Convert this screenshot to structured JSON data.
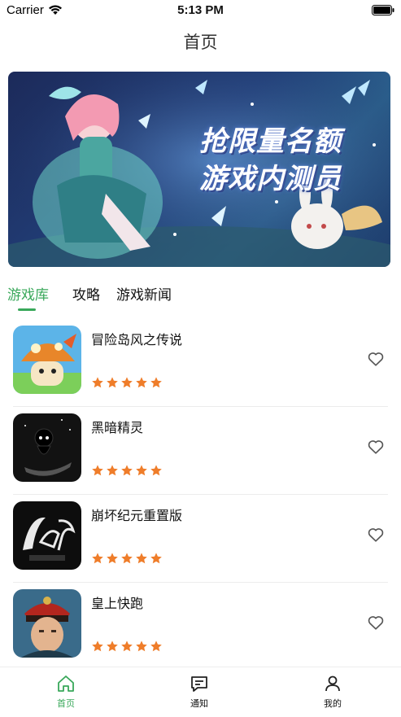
{
  "status_bar": {
    "carrier": "Carrier",
    "time": "5:13 PM",
    "wifi_icon": "wifi-icon",
    "battery_icon": "battery-icon"
  },
  "nav": {
    "title": "首页"
  },
  "banner": {
    "line1": "抢限量名额",
    "line2": "游戏内测员"
  },
  "tabs": [
    {
      "label": "游戏库",
      "active": true
    },
    {
      "label": "攻略",
      "active": false
    },
    {
      "label": "游戏新闻",
      "active": false
    }
  ],
  "colors": {
    "accent": "#39a85a",
    "star": "#ef7d2a"
  },
  "games": [
    {
      "title": "冒险岛风之传说",
      "rating": 5,
      "icon": "mushroom-game-icon"
    },
    {
      "title": "黑暗精灵",
      "rating": 5,
      "icon": "dark-spirit-game-icon"
    },
    {
      "title": "崩坏纪元重置版",
      "rating": 5,
      "icon": "dnf-game-icon"
    },
    {
      "title": "皇上快跑",
      "rating": 5,
      "icon": "emperor-game-icon"
    }
  ],
  "tab_bar": [
    {
      "label": "首页",
      "icon": "home-icon",
      "active": true
    },
    {
      "label": "通知",
      "icon": "message-icon",
      "active": false
    },
    {
      "label": "我的",
      "icon": "user-icon",
      "active": false
    }
  ]
}
